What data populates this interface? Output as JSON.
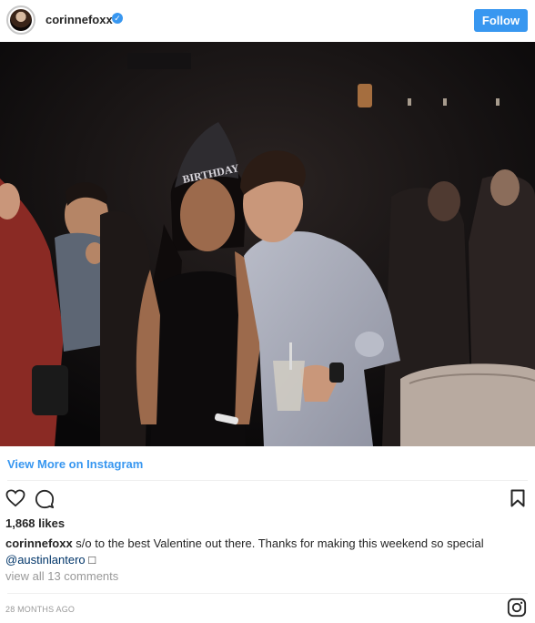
{
  "header": {
    "username": "corinnefoxx",
    "verified_symbol": "✓",
    "follow_label": "Follow"
  },
  "post": {
    "hat_text": "BIRTHDAY",
    "view_more_label": "View More on Instagram",
    "likes": "1,868 likes",
    "caption_user": "corinnefoxx",
    "caption_text": " s/o to the best Valentine out there. Thanks for making this weekend so special ",
    "caption_mention": "@austinlantero",
    "caption_emoji": "□",
    "view_comments": "view all 13 comments",
    "timestamp": "28 MONTHS AGO"
  },
  "icons": {
    "like": "heart-icon",
    "comment": "comment-icon",
    "save": "bookmark-icon",
    "brand": "instagram-icon"
  },
  "colors": {
    "accent": "#3897f0",
    "text": "#262626",
    "muted": "#999999",
    "mention": "#003569"
  }
}
